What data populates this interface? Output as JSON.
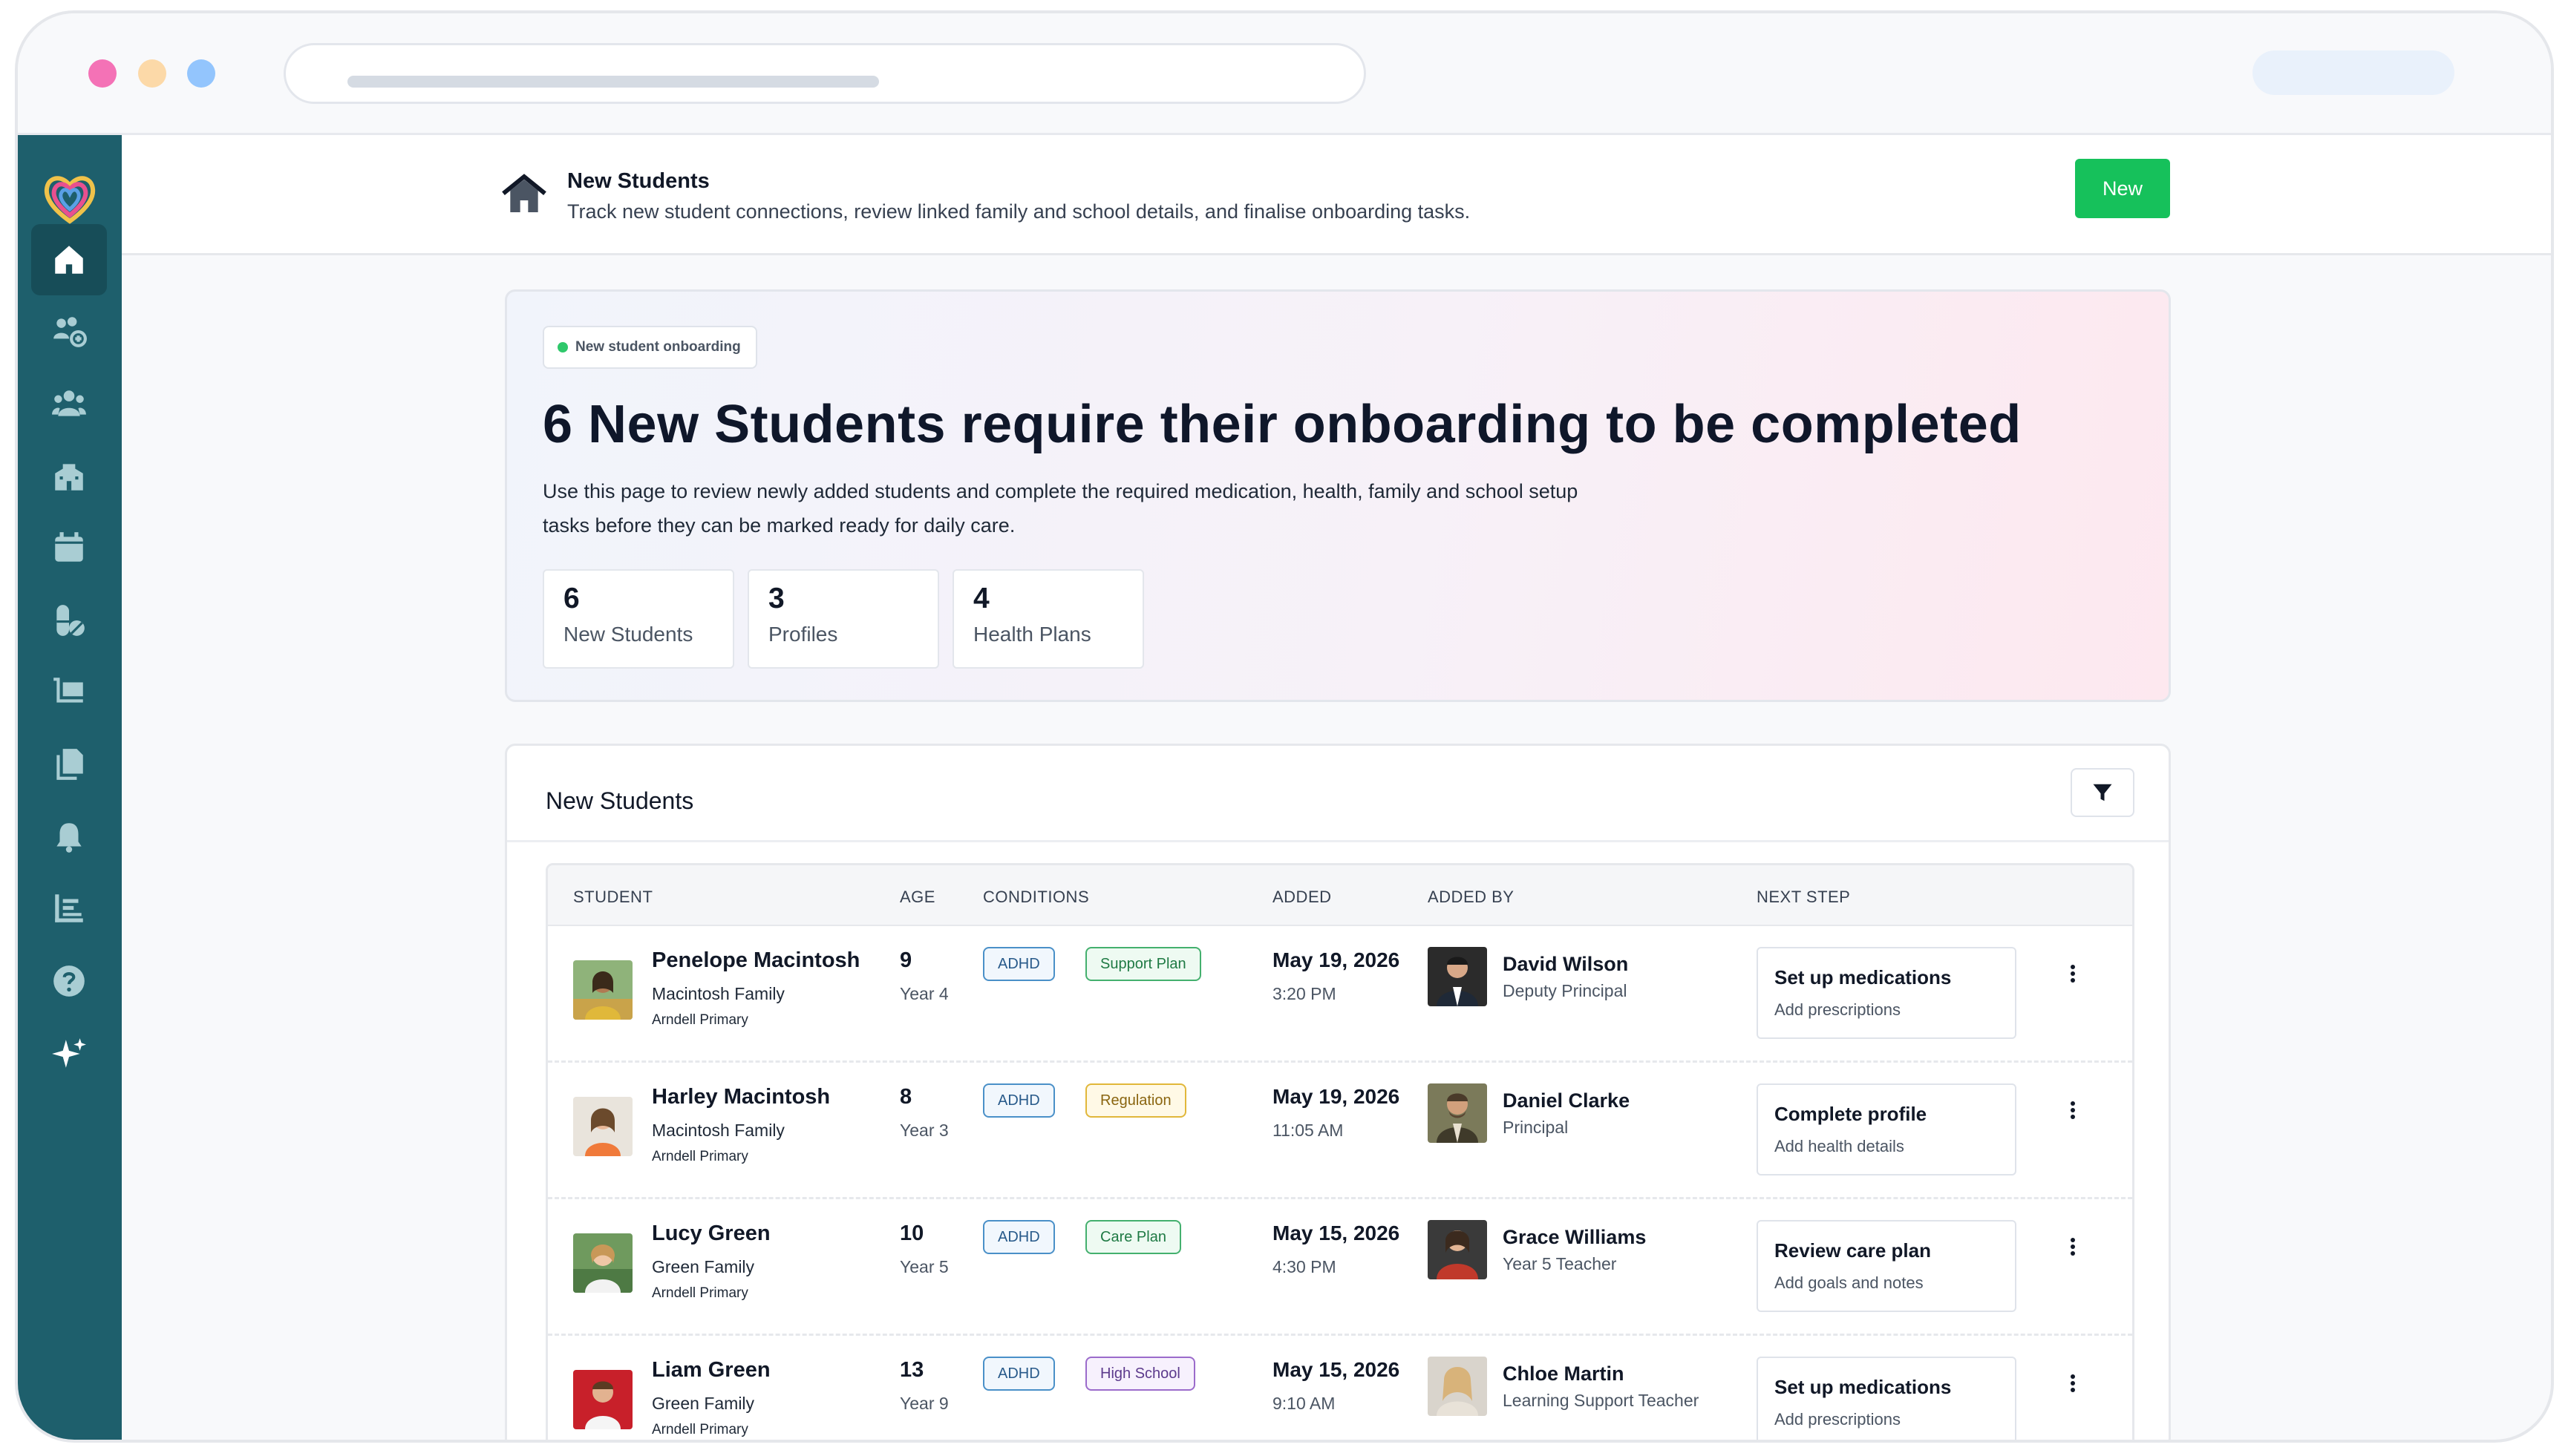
{
  "header": {
    "title": "New Students",
    "subtitle": "Track new student connections, review linked family and school details, and finalise onboarding tasks.",
    "new_label": "New"
  },
  "hero": {
    "chip": "New student onboarding",
    "heading": "6 New Students require their onboarding to be completed",
    "text": "Use this page to review newly added students and complete the required medication, health, family and school setup tasks before they can be marked ready for daily care.",
    "stats": [
      {
        "value": "6",
        "label": "New Students"
      },
      {
        "value": "3",
        "label": "Profiles"
      },
      {
        "value": "4",
        "label": "Health Plans"
      }
    ]
  },
  "table": {
    "title": "New Students",
    "columns": [
      "STUDENT",
      "AGE",
      "CONDITIONS",
      "ADDED",
      "ADDED BY",
      "NEXT STEP"
    ],
    "rows": [
      {
        "name": "Penelope Macintosh",
        "family": "Macintosh Family",
        "school": "Arndell Primary",
        "age": "9",
        "year": "Year 4",
        "condition1": "ADHD",
        "condition2": "Support Plan",
        "date": "May 19, 2026",
        "time": "3:20 PM",
        "added_by": "David Wilson",
        "role": "Deputy Principal",
        "next_title": "Set up medications",
        "next_sub": "Add prescriptions"
      },
      {
        "name": "Harley Macintosh",
        "family": "Macintosh Family",
        "school": "Arndell Primary",
        "age": "8",
        "year": "Year 3",
        "condition1": "ADHD",
        "condition2": "Regulation",
        "date": "May 19, 2026",
        "time": "11:05 AM",
        "added_by": "Daniel Clarke",
        "role": "Principal",
        "next_title": "Complete profile",
        "next_sub": "Add health details"
      },
      {
        "name": "Lucy Green",
        "family": "Green Family",
        "school": "Arndell Primary",
        "age": "10",
        "year": "Year 5",
        "condition1": "ADHD",
        "condition2": "Care Plan",
        "date": "May 15, 2026",
        "time": "4:30 PM",
        "added_by": "Grace Williams",
        "role": "Year 5 Teacher",
        "next_title": "Review care plan",
        "next_sub": "Add goals and notes"
      },
      {
        "name": "Liam Green",
        "family": "Green Family",
        "school": "Arndell Primary",
        "age": "13",
        "year": "Year 9",
        "condition1": "ADHD",
        "condition2": "High School",
        "date": "May 15, 2026",
        "time": "9:10 AM",
        "added_by": "Chloe Martin",
        "role": "Learning Support Teacher",
        "next_title": "Set up medications",
        "next_sub": "Add prescriptions"
      }
    ]
  },
  "colors": {
    "sidebar": "#1e5f6c",
    "accent_green": "#16c15b",
    "traffic_red": "#f472b6",
    "traffic_yellow": "#fcd9a8",
    "traffic_blue": "#93c5fd"
  },
  "icons": {
    "sidebar": [
      "home-icon",
      "group-add-icon",
      "people-icon",
      "school-icon",
      "calendar-icon",
      "medication-icon",
      "cart-icon",
      "documents-icon",
      "bell-icon",
      "report-icon",
      "help-icon",
      "sparkle-icon"
    ],
    "header": "house-icon",
    "filter": "filter-icon",
    "row_menu": "kebab-menu-icon"
  }
}
